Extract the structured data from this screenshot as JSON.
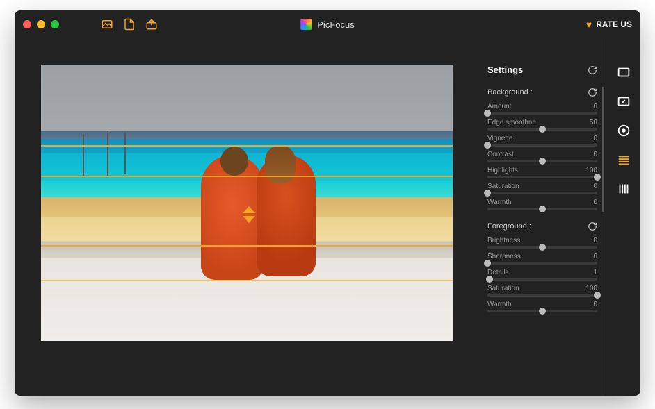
{
  "app": {
    "title": "PicFocus",
    "rate_label": "RATE US"
  },
  "settings": {
    "title": "Settings",
    "background": {
      "label": "Background :",
      "sliders": [
        {
          "label": "Amount",
          "value": 0,
          "pos": 0
        },
        {
          "label": "Edge smoothne",
          "value": 50,
          "pos": 50
        },
        {
          "label": "Vignette",
          "value": 0,
          "pos": 0
        },
        {
          "label": "Contrast",
          "value": 0,
          "pos": 50
        },
        {
          "label": "Highlights",
          "value": 100,
          "pos": 100
        },
        {
          "label": "Saturation",
          "value": 0,
          "pos": 0
        },
        {
          "label": "Warmth",
          "value": 0,
          "pos": 50
        }
      ]
    },
    "foreground": {
      "label": "Foreground :",
      "sliders": [
        {
          "label": "Brightness",
          "value": 0,
          "pos": 50
        },
        {
          "label": "Sharpness",
          "value": 0,
          "pos": 0
        },
        {
          "label": "Details",
          "value": 1,
          "pos": 2
        },
        {
          "label": "Saturation",
          "value": 100,
          "pos": 100
        },
        {
          "label": "Warmth",
          "value": 0,
          "pos": 50
        }
      ]
    }
  },
  "tools": {
    "active_index": 3
  }
}
